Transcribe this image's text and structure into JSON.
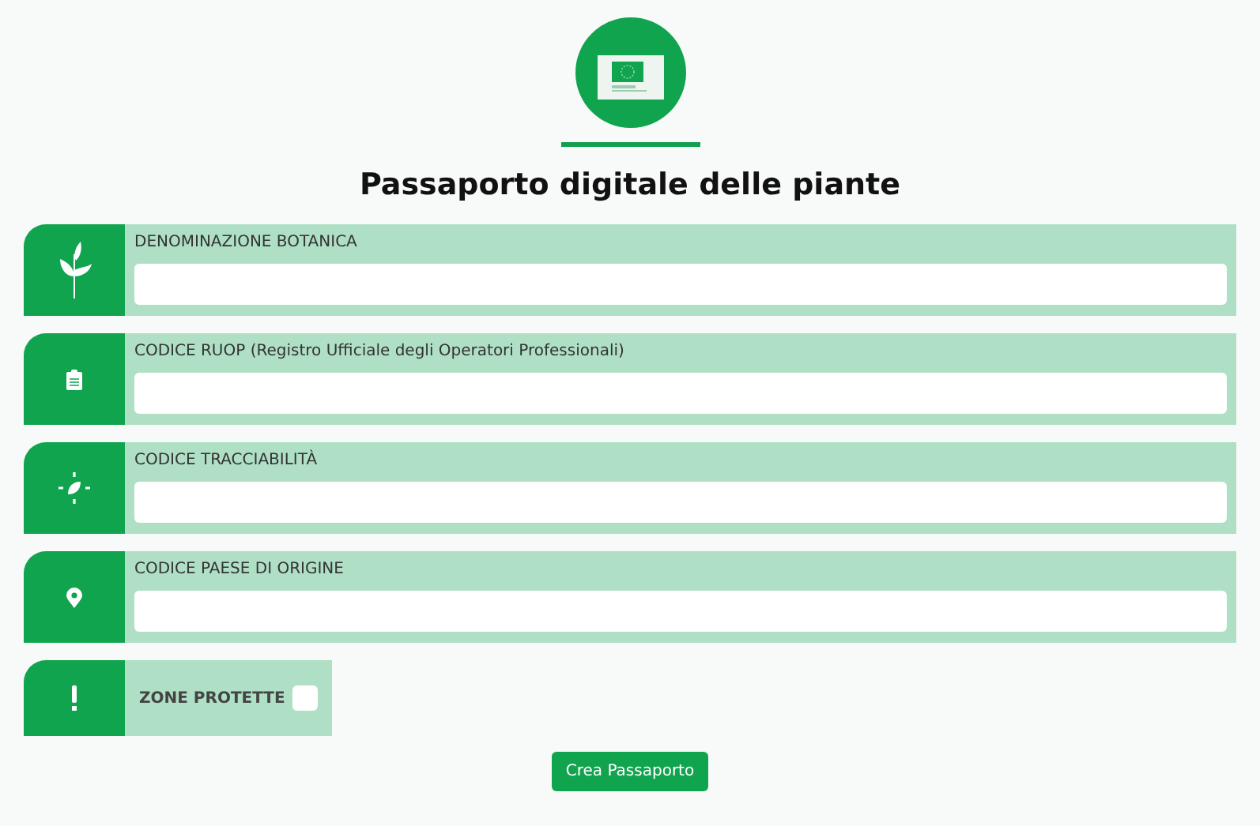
{
  "title": "Passaporto digitale delle piante",
  "fields": [
    {
      "kind": "text",
      "label": "DENOMINAZIONE BOTANICA"
    },
    {
      "kind": "text",
      "label": "CODICE RUOP (Registro Ufficiale degli Operatori Professionali)"
    },
    {
      "kind": "text",
      "label": "CODICE TRACCIABILITÀ"
    },
    {
      "kind": "text",
      "label": "CODICE PAESE DI ORIGINE"
    },
    {
      "kind": "checkbox",
      "label": "ZONE PROTETTE",
      "checked": false
    }
  ],
  "button": "Crea Passaporto"
}
